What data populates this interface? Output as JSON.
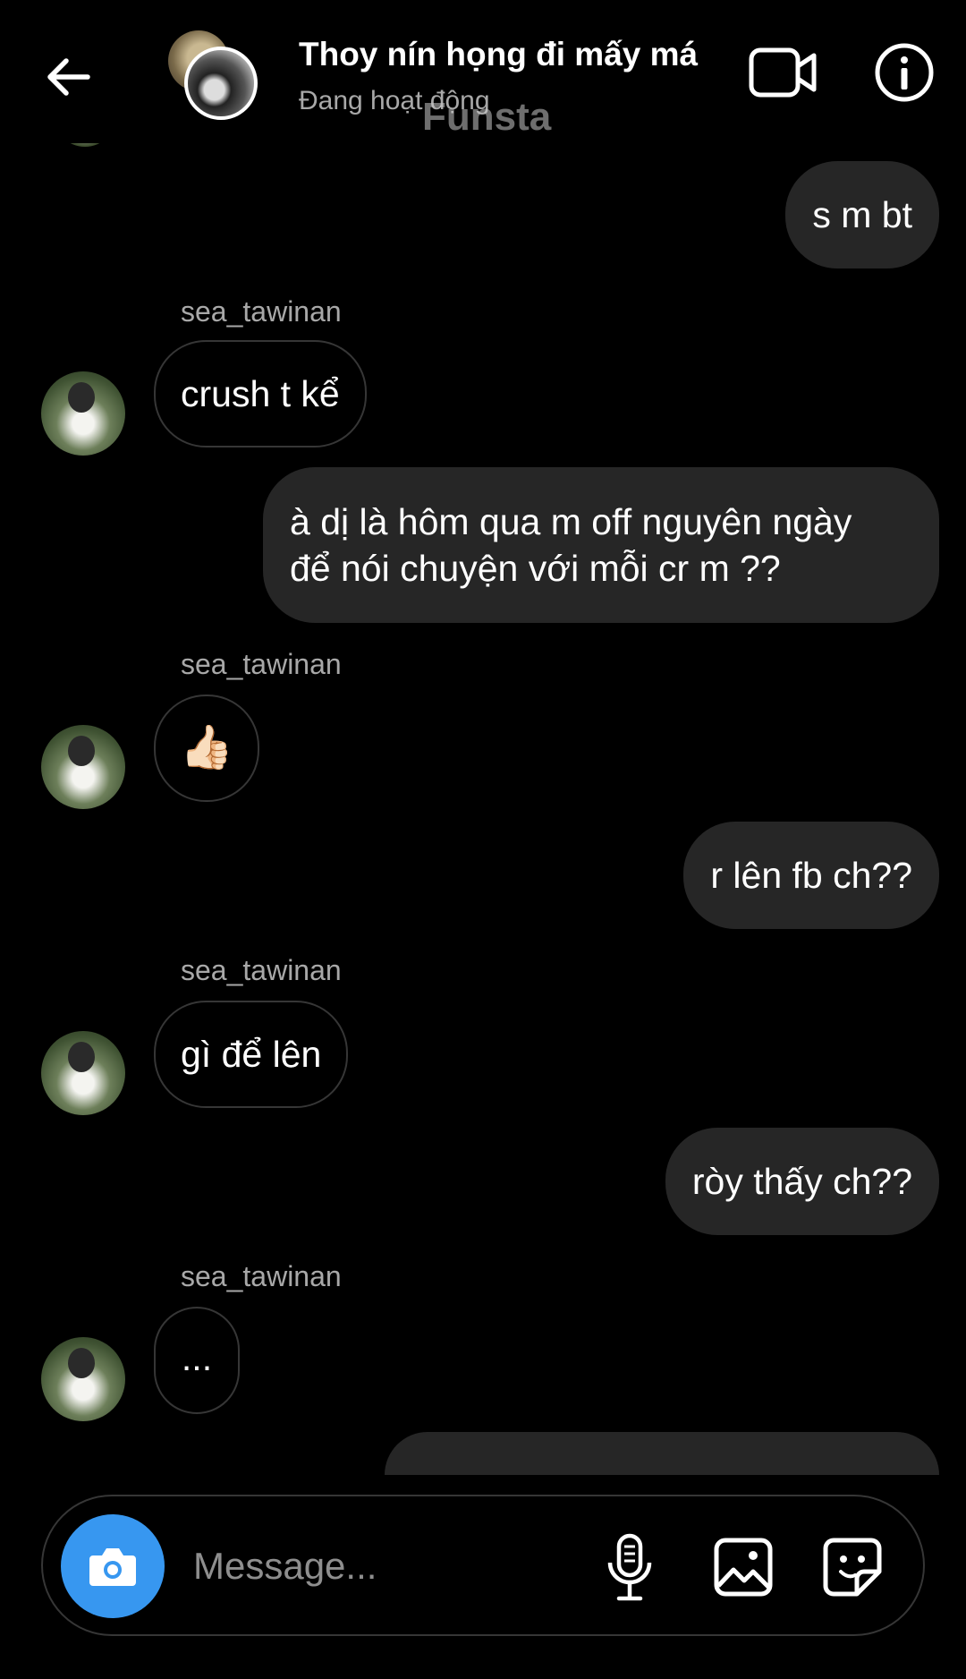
{
  "header": {
    "title": "Thoy nín họng đi mấy má",
    "status": "Đang hoạt động",
    "watermark": "Funsta"
  },
  "messages": [
    {
      "type": "outgoing",
      "text": "s m bt"
    },
    {
      "type": "incoming",
      "sender": "sea_tawinan",
      "text": "crush t kể"
    },
    {
      "type": "outgoing",
      "lines": [
        "à dị là hôm qua m off nguyên ngày",
        "để nói chuyện với mỗi cr m ??"
      ]
    },
    {
      "type": "incoming",
      "sender": "sea_tawinan",
      "text": "👍🏻"
    },
    {
      "type": "outgoing",
      "text": "r lên fb ch??"
    },
    {
      "type": "incoming",
      "sender": "sea_tawinan",
      "text": "gì để lên"
    },
    {
      "type": "outgoing",
      "text": "ròy thấy ch??"
    },
    {
      "type": "incoming",
      "sender": "sea_tawinan",
      "text": "..."
    }
  ],
  "composer": {
    "placeholder": "Message..."
  },
  "icons": {
    "back": "arrow-left-icon",
    "video": "video-camera-icon",
    "info": "info-icon",
    "camera": "camera-icon",
    "mic": "microphone-icon",
    "gallery": "image-icon",
    "sticker": "sticker-icon"
  },
  "colors": {
    "background": "#000000",
    "outgoing_bubble": "#262626",
    "incoming_border": "#363636",
    "camera_button": "#3797f0",
    "secondary_text": "#a8a8a8"
  }
}
